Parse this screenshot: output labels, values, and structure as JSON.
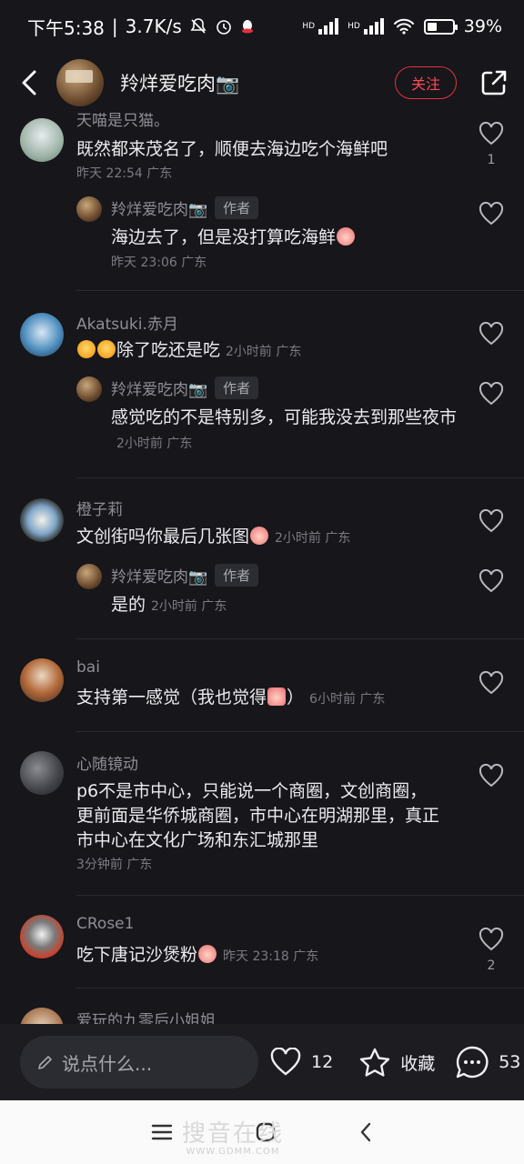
{
  "status_bar": {
    "time": "下午5:38",
    "speed": "3.7K/s",
    "hd1": "HD",
    "hd2": "HD",
    "battery": "39%",
    "battery_level": 0.39
  },
  "header": {
    "title": "羚烊爱吃肉📷",
    "follow_label": "关注"
  },
  "comments": [
    {
      "user": "天喵是只猫。",
      "text": "既然都来茂名了，顺便去海边吃个海鲜吧",
      "meta": "昨天 22:54 广东",
      "likes": "1",
      "reply": {
        "user": "羚烊爱吃肉📷",
        "tag": "作者",
        "text": "海边去了，但是没打算吃海鲜",
        "meta": "昨天 23:06 广东"
      }
    },
    {
      "user": "Akatsuki.赤月",
      "text": "除了吃还是吃",
      "meta": "2小时前  广东",
      "likes": "",
      "reply": {
        "user": "羚烊爱吃肉📷",
        "tag": "作者",
        "text": "感觉吃的不是特别多，可能我没去到那些夜市",
        "meta": "2小时前  广东"
      }
    },
    {
      "user": "橙子莉",
      "text": "文创街吗你最后几张图",
      "meta": "2小时前  广东",
      "likes": "",
      "reply": {
        "user": "羚烊爱吃肉📷",
        "tag": "作者",
        "text": "是的",
        "meta": "2小时前  广东"
      }
    },
    {
      "user": "bai",
      "text": "支持第一感觉（我也觉得",
      "text_end": "）",
      "meta": "6小时前  广东",
      "likes": ""
    },
    {
      "user": "心随镜动",
      "text": "p6不是市中心，只能说一个商圈，文创商圈，更前面是华侨城商圈，市中心在明湖那里，真正市中心在文化广场和东汇城那里",
      "meta": "3分钟前  广东",
      "likes": ""
    },
    {
      "user": "CRose1",
      "text": "吃下唐记沙煲粉",
      "meta": "昨天 23:18 广东",
      "likes": "2"
    },
    {
      "user": "爱玩的九零后小姐姐",
      "text": "",
      "meta": "",
      "likes": ""
    }
  ],
  "bottom_bar": {
    "placeholder": "说点什么...",
    "like_count": "12",
    "favorite_label": "收藏",
    "comment_count": "53"
  },
  "watermark": {
    "text": "搜音在线",
    "url": "WWW.GDMM.COM"
  },
  "colors": {
    "background": "#16161b",
    "accent": "#e5323e"
  }
}
